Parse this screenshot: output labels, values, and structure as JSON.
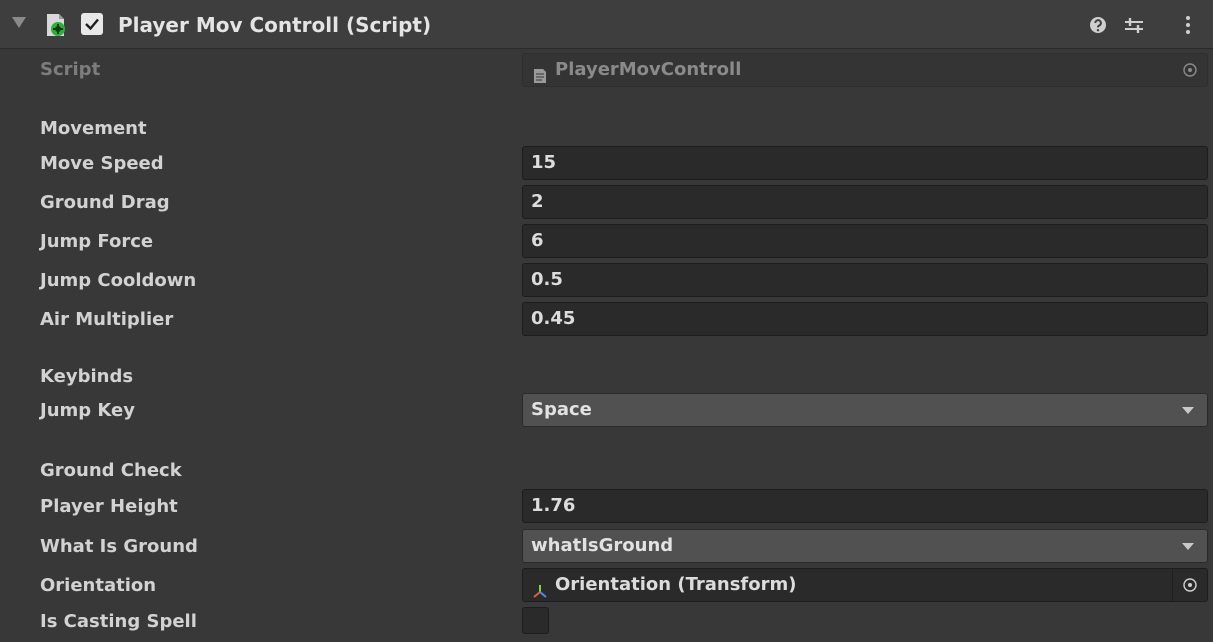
{
  "component": {
    "title": "Player Mov Controll (Script)",
    "enabled": true,
    "icons": [
      "script-component-icon",
      "help-icon",
      "presets-icon",
      "context-menu-icon"
    ]
  },
  "script": {
    "label": "Script",
    "value": "PlayerMovControll"
  },
  "movement": {
    "header": "Movement",
    "move_speed": {
      "label": "Move Speed",
      "value": "15"
    },
    "ground_drag": {
      "label": "Ground Drag",
      "value": "2"
    },
    "jump_force": {
      "label": "Jump Force",
      "value": "6"
    },
    "jump_cooldown": {
      "label": "Jump Cooldown",
      "value": "0.5"
    },
    "air_multiplier": {
      "label": "Air Multiplier",
      "value": "0.45"
    }
  },
  "keybinds": {
    "header": "Keybinds",
    "jump_key": {
      "label": "Jump Key",
      "value": "Space"
    }
  },
  "ground_check": {
    "header": "Ground Check",
    "player_height": {
      "label": "Player Height",
      "value": "1.76"
    },
    "what_is_ground": {
      "label": "What Is Ground",
      "value": "whatIsGround"
    }
  },
  "orientation": {
    "label": "Orientation",
    "value": "Orientation (Transform)"
  },
  "is_casting_spell": {
    "label": "Is Casting Spell",
    "checked": false
  },
  "colors": {
    "background": "#383838",
    "header": "#3e3e3e",
    "field": "#2a2a2a",
    "dropdown": "#515151",
    "text": "#d2d2d2"
  }
}
